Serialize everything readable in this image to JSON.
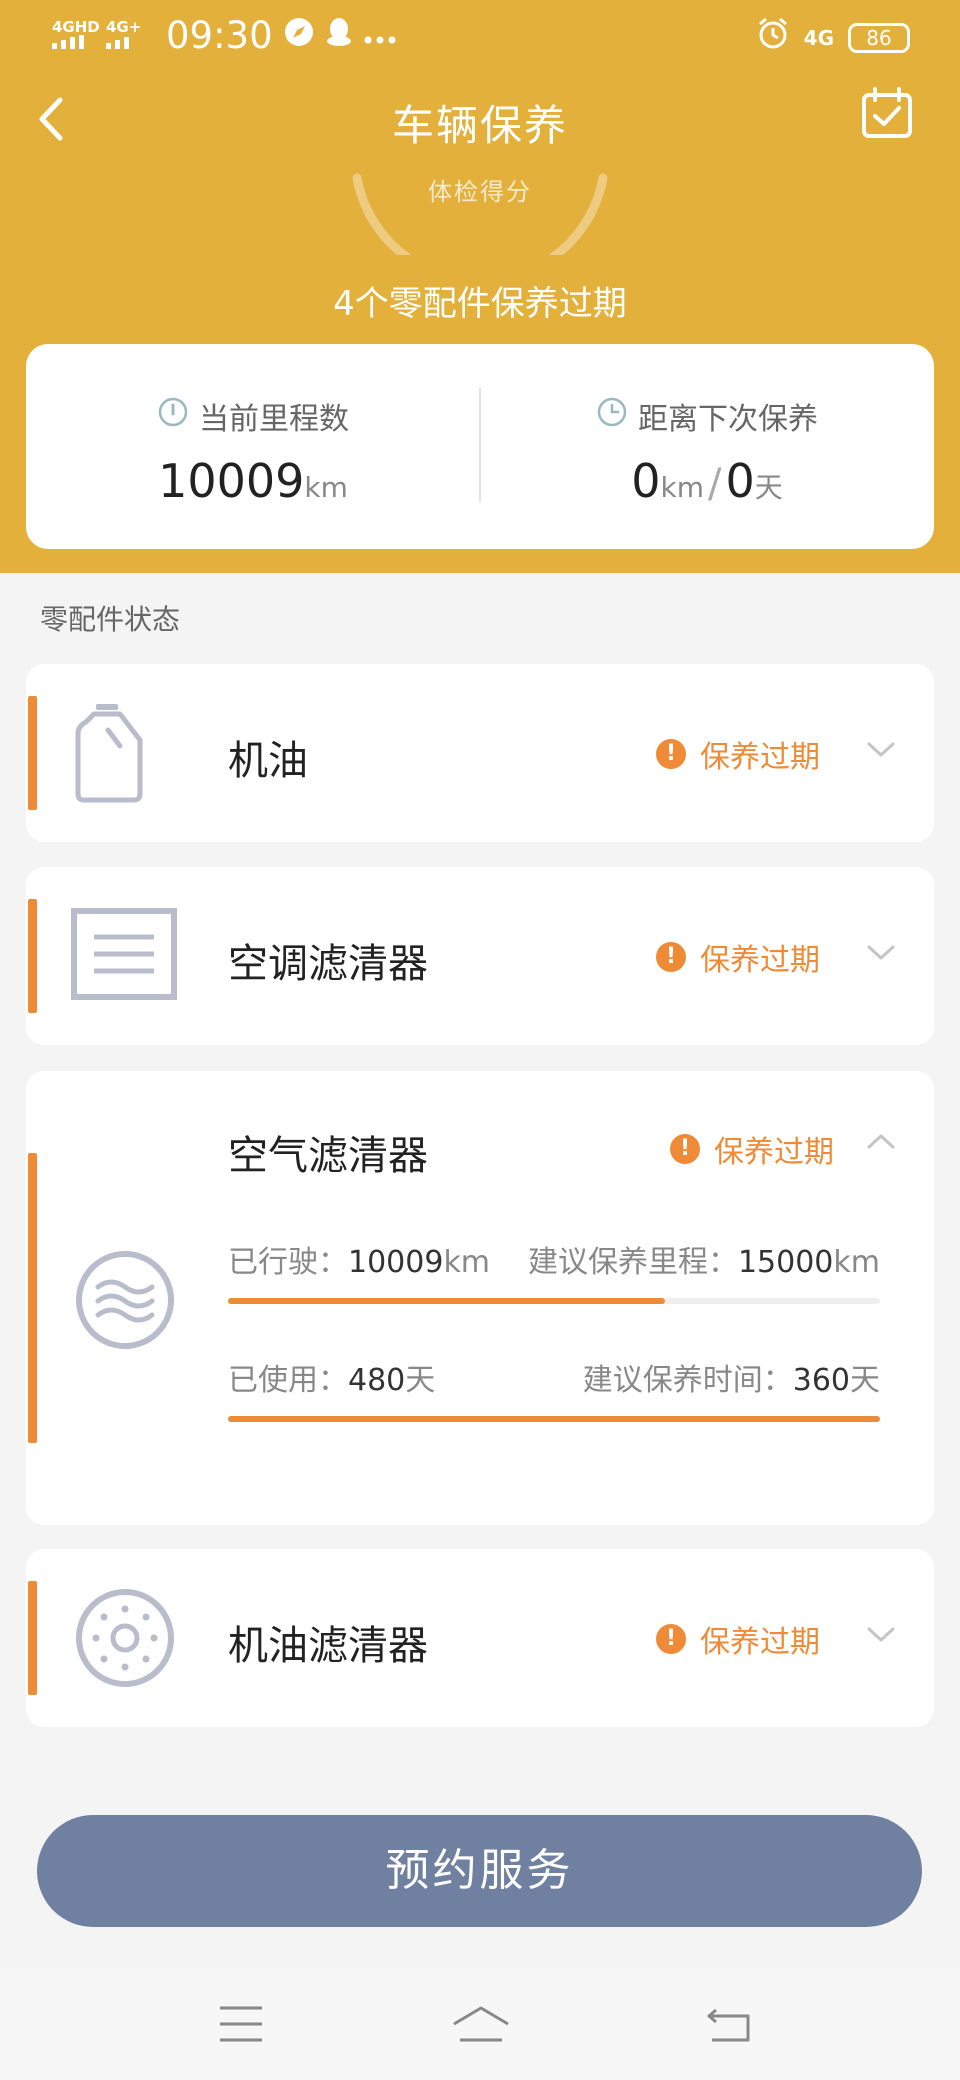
{
  "status_bar": {
    "signal_1": "4GHD",
    "signal_2": "4G+",
    "time": "09:30",
    "network": "4G",
    "battery": "86"
  },
  "header": {
    "title": "车辆保养",
    "gauge_label": "体检得分",
    "overdue_summary": "4个零配件保养过期",
    "background_color": "#e3b03c"
  },
  "stats": {
    "mileage_label": "当前里程数",
    "mileage_value": "10009",
    "mileage_unit": "km",
    "next_label": "距离下次保养",
    "next_km": "0",
    "next_km_unit": "km",
    "next_days": "0",
    "next_days_unit": "天"
  },
  "section_label": "零配件状态",
  "parts": [
    {
      "name": "机油",
      "status": "保养过期",
      "icon": "oil-bottle-icon"
    },
    {
      "name": "空调滤清器",
      "status": "保养过期",
      "icon": "ac-filter-icon"
    },
    {
      "name": "空气滤清器",
      "status": "保养过期",
      "icon": "air-filter-icon",
      "driven_label": "已行驶：",
      "driven_value": "10009",
      "driven_unit": "km",
      "suggest_km_label": "建议保养里程：",
      "suggest_km_value": "15000",
      "suggest_km_unit": "km",
      "mileage_progress": 0.67,
      "used_label": "已使用：",
      "used_value": "480",
      "used_unit": "天",
      "suggest_time_label": "建议保养时间：",
      "suggest_time_value": "360",
      "suggest_time_unit": "天",
      "time_progress": 1.0
    },
    {
      "name": "机油滤清器",
      "status": "保养过期",
      "icon": "oil-filter-icon"
    }
  ],
  "book_button": "预约服务",
  "accent_color": "#ef8a36",
  "button_color": "#7080a0"
}
